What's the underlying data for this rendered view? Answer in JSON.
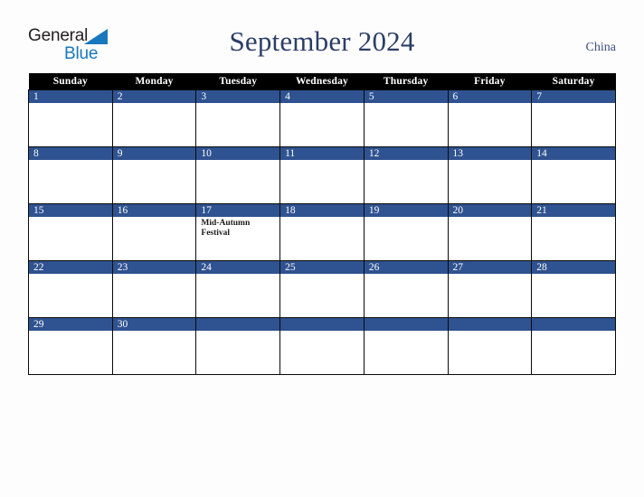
{
  "brand": {
    "name_part1": "General",
    "name_part2": "Blue",
    "triangle_icon": "brand-triangle-icon",
    "colors": {
      "general_text": "#231f20",
      "blue_text": "#1878be"
    }
  },
  "header": {
    "title": "September 2024",
    "country": "China",
    "title_color": "#2c3e66",
    "country_color": "#3b4f7d"
  },
  "calendar": {
    "month": "September",
    "year": "2024",
    "weekday_headers": [
      "Sunday",
      "Monday",
      "Tuesday",
      "Wednesday",
      "Thursday",
      "Friday",
      "Saturday"
    ],
    "header_bg": "#000000",
    "header_text": "#ffffff",
    "daybar_bg": "#2f5290",
    "daybar_text": "#ffffff",
    "cell_bg": "#ffffff",
    "border_color": "#0a0a0a",
    "weeks": [
      [
        {
          "day": "1",
          "events": []
        },
        {
          "day": "2",
          "events": []
        },
        {
          "day": "3",
          "events": []
        },
        {
          "day": "4",
          "events": []
        },
        {
          "day": "5",
          "events": []
        },
        {
          "day": "6",
          "events": []
        },
        {
          "day": "7",
          "events": []
        }
      ],
      [
        {
          "day": "8",
          "events": []
        },
        {
          "day": "9",
          "events": []
        },
        {
          "day": "10",
          "events": []
        },
        {
          "day": "11",
          "events": []
        },
        {
          "day": "12",
          "events": []
        },
        {
          "day": "13",
          "events": []
        },
        {
          "day": "14",
          "events": []
        }
      ],
      [
        {
          "day": "15",
          "events": []
        },
        {
          "day": "16",
          "events": []
        },
        {
          "day": "17",
          "events": [
            "Mid-Autumn Festival"
          ]
        },
        {
          "day": "18",
          "events": []
        },
        {
          "day": "19",
          "events": []
        },
        {
          "day": "20",
          "events": []
        },
        {
          "day": "21",
          "events": []
        }
      ],
      [
        {
          "day": "22",
          "events": []
        },
        {
          "day": "23",
          "events": []
        },
        {
          "day": "24",
          "events": []
        },
        {
          "day": "25",
          "events": []
        },
        {
          "day": "26",
          "events": []
        },
        {
          "day": "27",
          "events": []
        },
        {
          "day": "28",
          "events": []
        }
      ],
      [
        {
          "day": "29",
          "events": []
        },
        {
          "day": "30",
          "events": []
        },
        {
          "day": "",
          "events": []
        },
        {
          "day": "",
          "events": []
        },
        {
          "day": "",
          "events": []
        },
        {
          "day": "",
          "events": []
        },
        {
          "day": "",
          "events": []
        }
      ]
    ]
  }
}
